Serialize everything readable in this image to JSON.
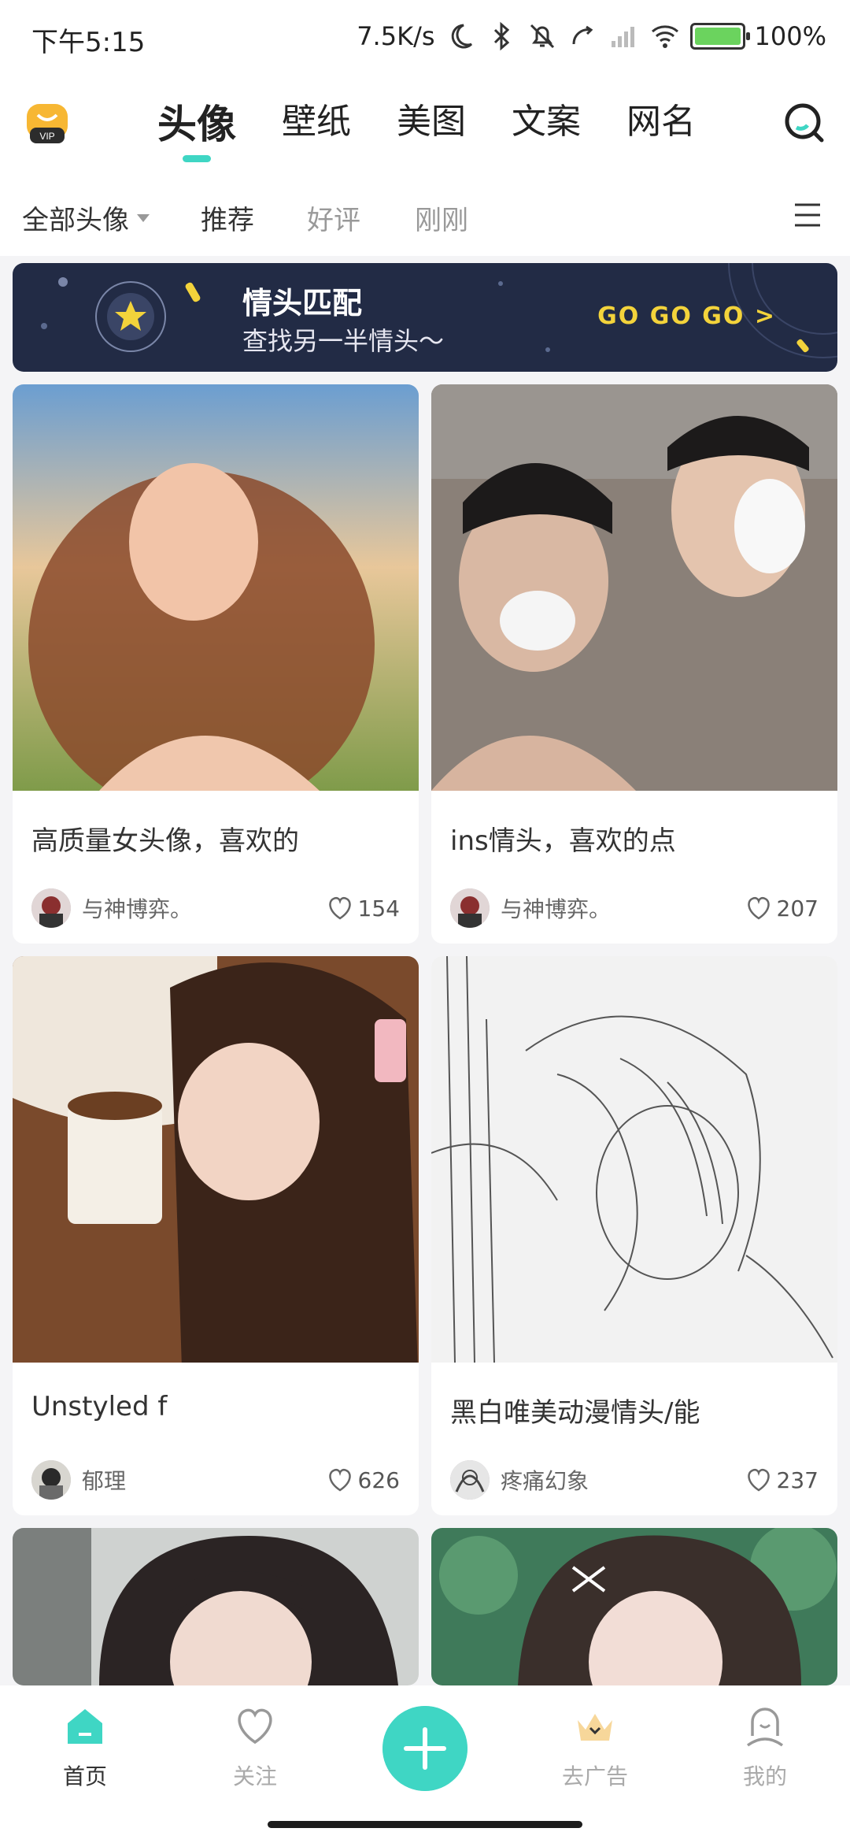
{
  "status_bar": {
    "time": "下午5:15",
    "net_speed": "7.5K/s",
    "battery": "100%",
    "battery_level": 1.0
  },
  "top_nav": {
    "vip_label": "VIP",
    "tabs": [
      {
        "label": "头像",
        "active": true
      },
      {
        "label": "壁纸",
        "active": false
      },
      {
        "label": "美图",
        "active": false
      },
      {
        "label": "文案",
        "active": false
      },
      {
        "label": "网名",
        "active": false
      }
    ]
  },
  "filters": {
    "all": "全部头像",
    "items": [
      "推荐",
      "好评",
      "刚刚"
    ]
  },
  "banner": {
    "title": "情头匹配",
    "subtitle": "查找另一半情头～",
    "cta": "GO GO GO >"
  },
  "cards": [
    {
      "title": "高质量女头像，喜欢的",
      "author": "与神博弈。",
      "likes": "154"
    },
    {
      "title": "ins情头，喜欢的点",
      "author": "与神博弈。",
      "likes": "207"
    },
    {
      "title": "Unstyled f",
      "author": "郁理",
      "likes": "626"
    },
    {
      "title": "黑白唯美动漫情头/能",
      "author": "疼痛幻象",
      "likes": "237"
    }
  ],
  "bottom_nav": {
    "items": [
      {
        "label": "首页",
        "icon": "home-icon"
      },
      {
        "label": "关注",
        "icon": "heart-icon"
      },
      {
        "label": "去广告",
        "icon": "crown-icon"
      },
      {
        "label": "我的",
        "icon": "profile-icon"
      }
    ],
    "add_icon": "plus-icon"
  },
  "colors": {
    "accent": "#3fd6c4",
    "banner_bg": "#222b45",
    "banner_cta": "#f3d33b"
  }
}
